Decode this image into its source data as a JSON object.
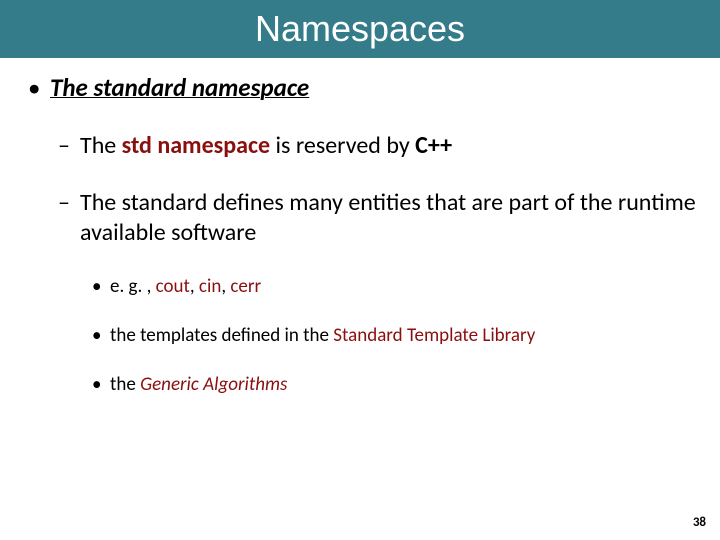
{
  "title": "Namespaces",
  "lvl1": {
    "bullet": "•",
    "text": "The standard namespace"
  },
  "lvl2a": {
    "dash": "–",
    "pre": "The ",
    "kw": "std namespace",
    "post": " is reserved by ",
    "strong": "C++"
  },
  "lvl2b": {
    "dash": "–",
    "text": "The standard defines many entities that are part of the runtime available software"
  },
  "lvl3a": {
    "bullet": "•",
    "pre": "e. g. , ",
    "k1": "cout",
    "c1": ", ",
    "k2": "cin",
    "c2": ", ",
    "k3": "cerr"
  },
  "lvl3b": {
    "bullet": "•",
    "pre": "the templates defined in the ",
    "kw": "Standard Template Library"
  },
  "lvl3c": {
    "bullet": "•",
    "pre": "the ",
    "kw": "Generic Algorithms"
  },
  "page": "38"
}
